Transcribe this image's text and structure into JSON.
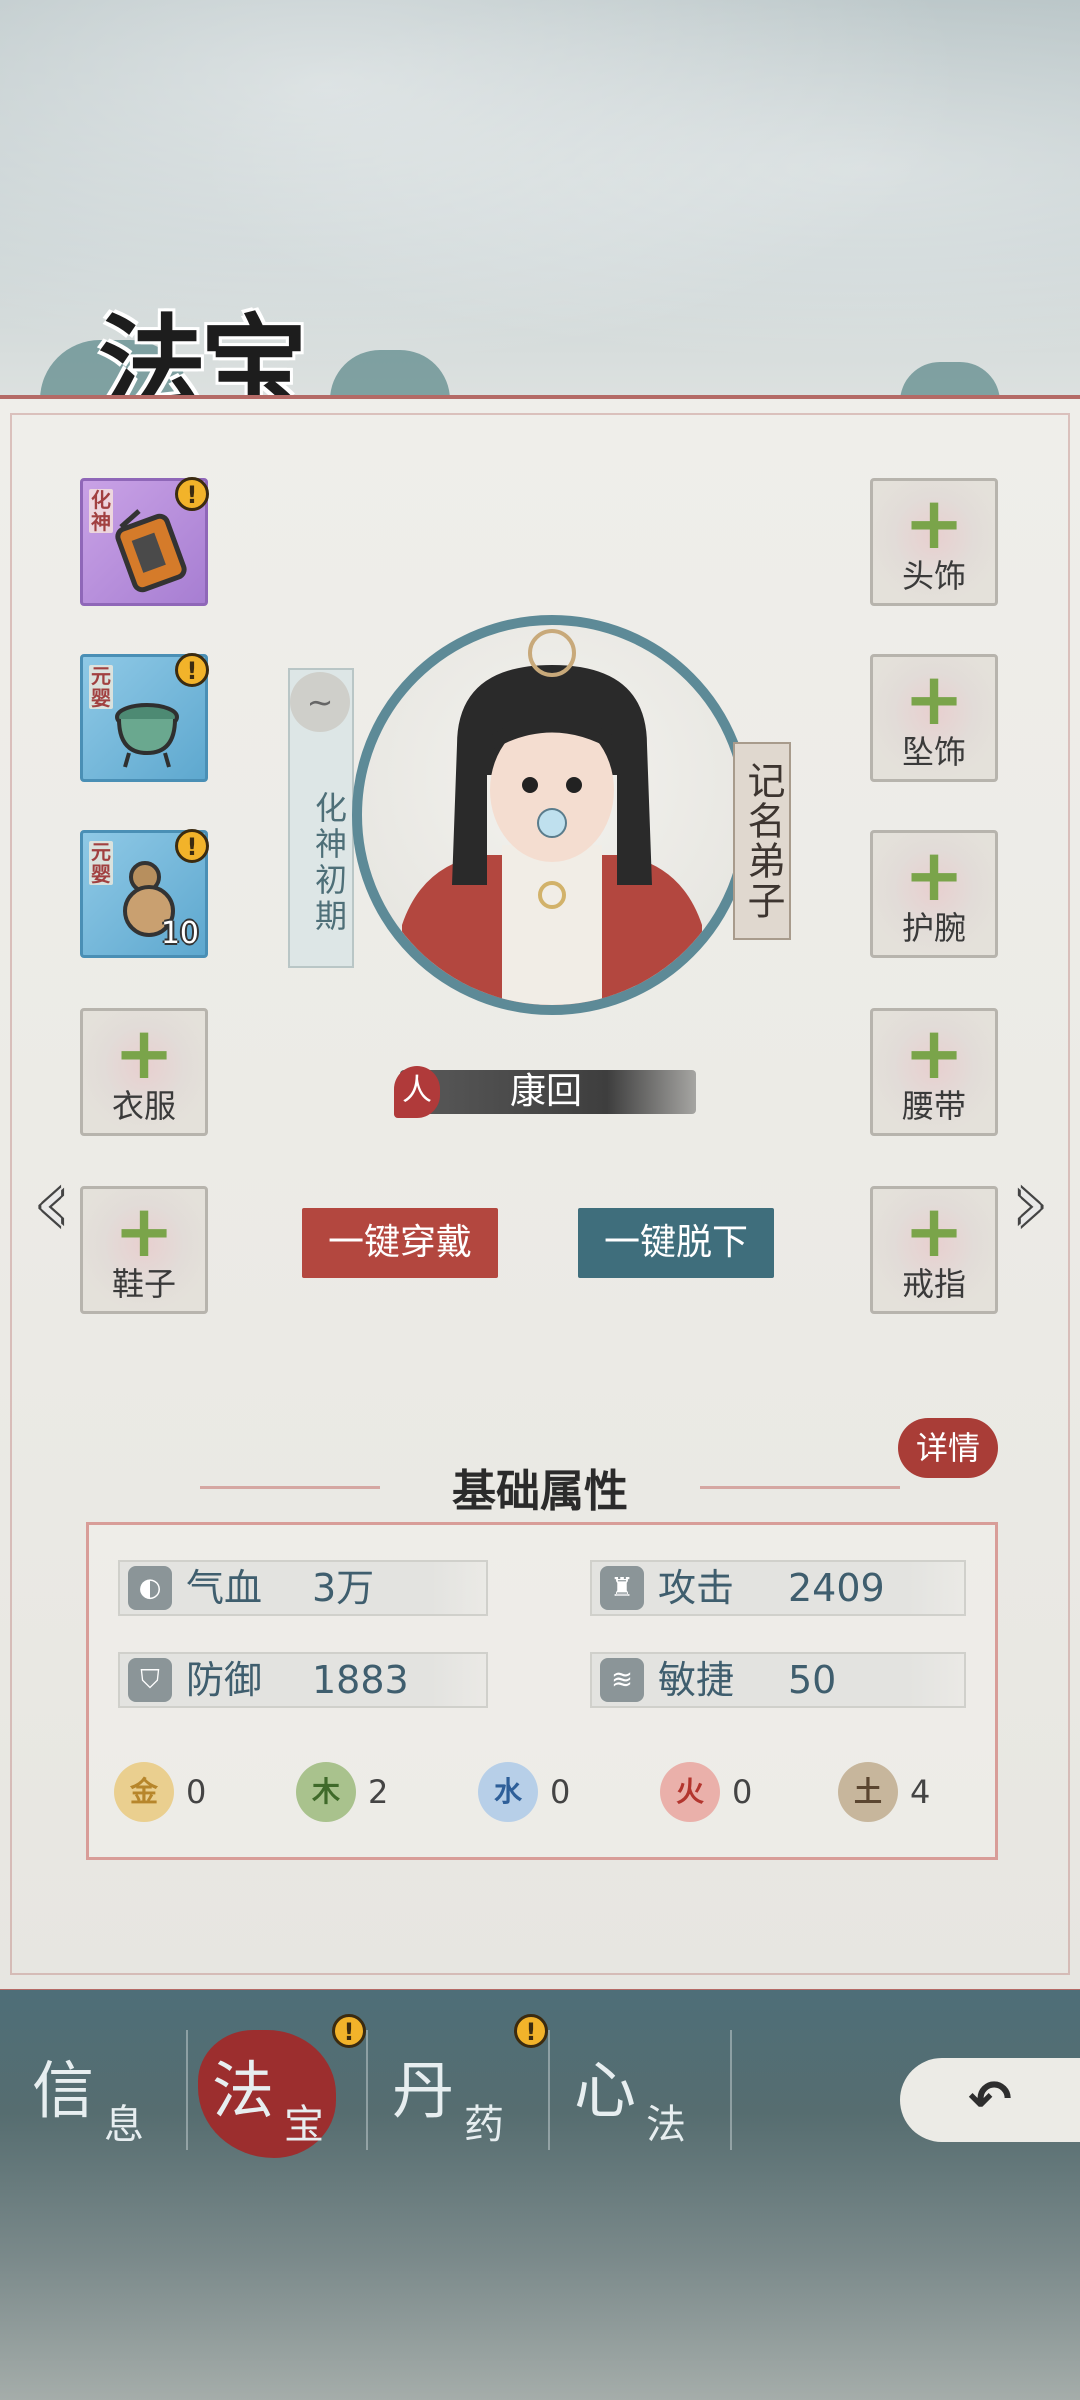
{
  "title": "法宝",
  "left_slots": [
    {
      "type": "item",
      "rank": "化神",
      "rarity": "purple",
      "alert": "!",
      "icon": "lantern-item-icon"
    },
    {
      "type": "item",
      "rank": "元婴",
      "rarity": "blue",
      "alert": "!",
      "icon": "cauldron-item-icon"
    },
    {
      "type": "item",
      "rank": "元婴",
      "rarity": "blue",
      "alert": "!",
      "icon": "gourd-item-icon",
      "count": "10"
    },
    {
      "type": "empty",
      "label": "衣服",
      "plus": "+"
    },
    {
      "type": "empty",
      "label": "鞋子",
      "plus": "+"
    }
  ],
  "right_slots": [
    {
      "label": "头饰",
      "plus": "+"
    },
    {
      "label": "坠饰",
      "plus": "+"
    },
    {
      "label": "护腕",
      "plus": "+"
    },
    {
      "label": "腰带",
      "plus": "+"
    },
    {
      "label": "戒指",
      "plus": "+"
    }
  ],
  "character": {
    "realm": "化神初期",
    "title": "记名弟子",
    "race": "人",
    "name": "康回"
  },
  "buttons": {
    "equip_all": "一键穿戴",
    "unequip_all": "一键脱下",
    "detail": "详情",
    "back_icon": "back-arrow-icon",
    "prev_icon": "chevron-left-icon",
    "next_icon": "chevron-right-icon"
  },
  "stats": {
    "heading": "基础属性",
    "rows": [
      {
        "name": "气血",
        "value": "3万",
        "icon": "blood-drop-icon"
      },
      {
        "name": "攻击",
        "value": "2409",
        "icon": "attack-icon"
      },
      {
        "name": "防御",
        "value": "1883",
        "icon": "shield-icon"
      },
      {
        "name": "敏捷",
        "value": "50",
        "icon": "wing-icon"
      }
    ],
    "elements": [
      {
        "glyph": "金",
        "value": "0",
        "color": "#e2b95a"
      },
      {
        "glyph": "木",
        "value": "2",
        "color": "#7fa35c"
      },
      {
        "glyph": "水",
        "value": "0",
        "color": "#6a9ad0"
      },
      {
        "glyph": "火",
        "value": "0",
        "color": "#d0645e"
      },
      {
        "glyph": "土",
        "value": "4",
        "color": "#a48b67"
      }
    ]
  },
  "nav": {
    "tabs": [
      {
        "big": "信",
        "small": "息",
        "active": false
      },
      {
        "big": "法",
        "small": "宝",
        "active": true,
        "alert": "!"
      },
      {
        "big": "丹",
        "small": "药",
        "active": false,
        "alert": "!"
      },
      {
        "big": "心",
        "small": "法",
        "active": false
      }
    ]
  }
}
